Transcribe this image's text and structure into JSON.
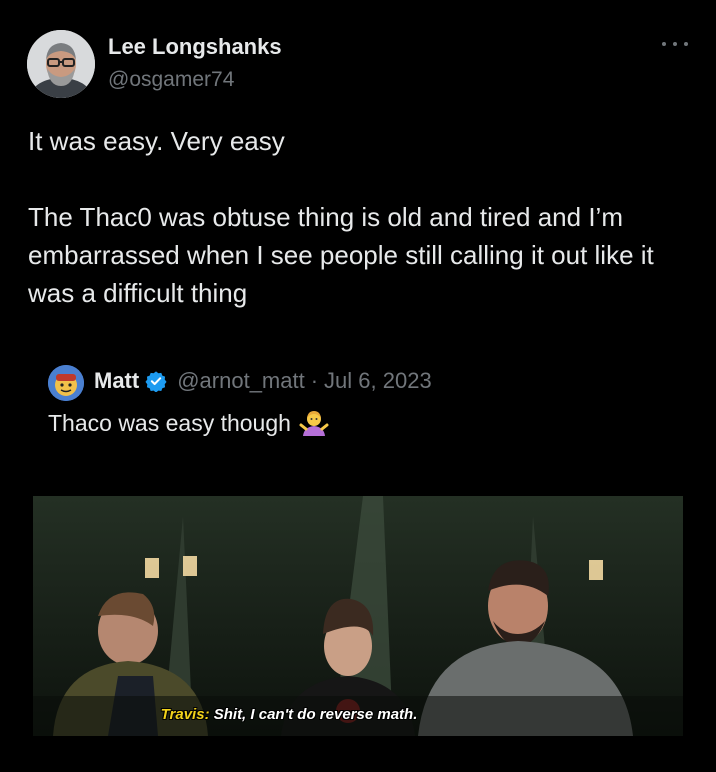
{
  "author": {
    "display_name": "Lee Longshanks",
    "handle": "@osgamer74",
    "avatar_icon": "user-avatar-bearded-man-glasses"
  },
  "more_icon": "more-horizontal-icon",
  "tweet": {
    "line1": "It was easy. Very easy",
    "line2": "The Thac0 was obtuse thing is old and tired and I’m embarrassed when I see people still calling it out like it was a difficult thing"
  },
  "quoted": {
    "display_name": "Matt",
    "verified_icon": "verified-badge-icon",
    "handle": "@arnot_matt",
    "separator": "·",
    "date": "Jul 6, 2023",
    "text": "Thaco was easy though",
    "emoji_icon": "person-shrugging-emoji"
  },
  "media": {
    "subtitle_speaker": "Travis:",
    "subtitle_line": " Shit, I can't do reverse math."
  },
  "colors": {
    "background": "#000000",
    "primary_text": "#e7e9ea",
    "secondary_text": "#71767b",
    "verified_blue": "#1d9bf0",
    "subtitle_yellow": "#f2d21a"
  }
}
